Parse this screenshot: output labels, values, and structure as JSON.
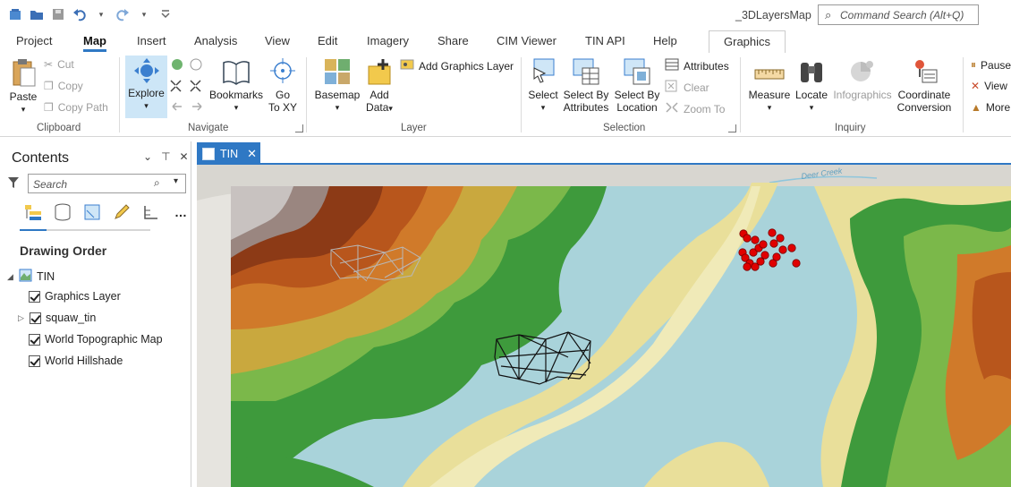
{
  "app": {
    "document_title": "_3DLayersMap",
    "command_search_placeholder": "Command Search (Alt+Q)"
  },
  "quick_access": [
    "new-project-icon",
    "open-project-icon",
    "save-project-icon",
    "undo-icon",
    "redo-icon",
    "customize-icon"
  ],
  "ribbon_tabs": [
    {
      "label": "Project"
    },
    {
      "label": "Map",
      "active": true
    },
    {
      "label": "Insert"
    },
    {
      "label": "Analysis"
    },
    {
      "label": "View"
    },
    {
      "label": "Edit"
    },
    {
      "label": "Imagery"
    },
    {
      "label": "Share"
    },
    {
      "label": "CIM Viewer"
    },
    {
      "label": "TIN API"
    },
    {
      "label": "Help"
    },
    {
      "label": "Graphics",
      "contextual": true
    }
  ],
  "ribbon": {
    "clipboard": {
      "group": "Clipboard",
      "paste": "Paste",
      "cut": "Cut",
      "copy": "Copy",
      "copy_path": "Copy Path"
    },
    "navigate": {
      "group": "Navigate",
      "explore": "Explore",
      "bookmarks": "Bookmarks",
      "go_to_xy_1": "Go",
      "go_to_xy_2": "To XY"
    },
    "layer": {
      "group": "Layer",
      "basemap": "Basemap",
      "add_data_1": "Add",
      "add_data_2": "Data",
      "add_graphics_layer": "Add Graphics Layer"
    },
    "selection": {
      "group": "Selection",
      "select": "Select",
      "select_by_attr_1": "Select By",
      "select_by_attr_2": "Attributes",
      "select_by_loc_1": "Select By",
      "select_by_loc_2": "Location",
      "attributes": "Attributes",
      "clear": "Clear",
      "zoom_to": "Zoom To"
    },
    "inquiry": {
      "group": "Inquiry",
      "measure": "Measure",
      "locate": "Locate",
      "infographics": "Infographics",
      "coord_conv_1": "Coordinate",
      "coord_conv_2": "Conversion"
    },
    "overflow": {
      "pause": "Pause",
      "view": "View",
      "more": "More"
    }
  },
  "contents": {
    "title": "Contents",
    "search_placeholder": "Search",
    "section": "Drawing Order",
    "map_name": "TIN",
    "layers": [
      {
        "name": "Graphics Layer",
        "checked": true,
        "expandable": false
      },
      {
        "name": "squaw_tin",
        "checked": true,
        "expandable": true
      },
      {
        "name": "World Topographic Map",
        "checked": true,
        "expandable": false
      },
      {
        "name": "World Hillshade",
        "checked": true,
        "expandable": false
      }
    ]
  },
  "map_view": {
    "tab_label": "TIN",
    "map_labels": {
      "creek": "Deer Creek"
    },
    "colors": {
      "accent": "#2f78c4",
      "points": "#e00000",
      "water": "#9fcfdc"
    }
  }
}
